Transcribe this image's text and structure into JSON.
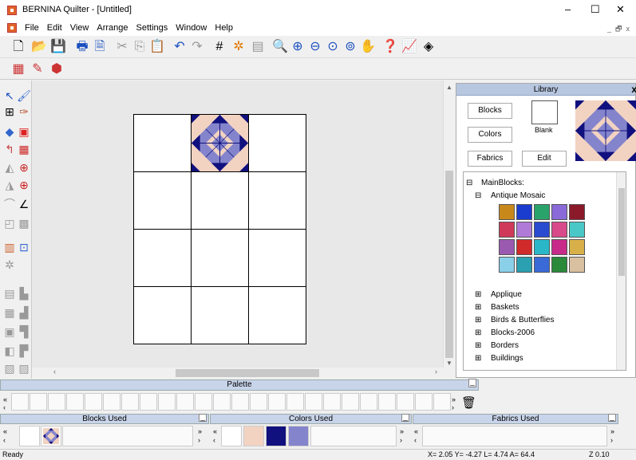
{
  "window": {
    "title": "BERNINA Quilter - [Untitled]",
    "min": "–",
    "max": "☐",
    "close": "✕"
  },
  "menu": {
    "items": [
      "File",
      "Edit",
      "View",
      "Arrange",
      "Settings",
      "Window",
      "Help"
    ]
  },
  "library": {
    "title": "Library",
    "close": "x",
    "buttons": {
      "blocks": "Blocks",
      "colors": "Colors",
      "fabrics": "Fabrics",
      "edit": "Edit",
      "blank": "Blank"
    },
    "tree": {
      "root": "MainBlocks:",
      "open_category": "Antique Mosaic",
      "categories": [
        "Applique",
        "Baskets",
        "Birds & Butterflies",
        "Blocks-2006",
        "Borders",
        "Buildings"
      ]
    }
  },
  "palette": {
    "title": "Palette",
    "left": "«",
    "left2": "‹",
    "right": "»",
    "right2": "›"
  },
  "used": {
    "blocks": "Blocks Used",
    "colors": "Colors Used",
    "fabrics": "Fabrics Used",
    "dash": "_",
    "colors_swatches": [
      "#f2d3c1",
      "#10107e",
      "#8484cc"
    ]
  },
  "status": {
    "ready": "Ready",
    "coords": "X=  2.05 Y=  -4.27 L=  4.74 A=  64.4",
    "zoom": "Z 0.10"
  },
  "colors": {
    "navy": "#10107e",
    "lavender": "#8484cc",
    "peach": "#f2d3c1"
  }
}
